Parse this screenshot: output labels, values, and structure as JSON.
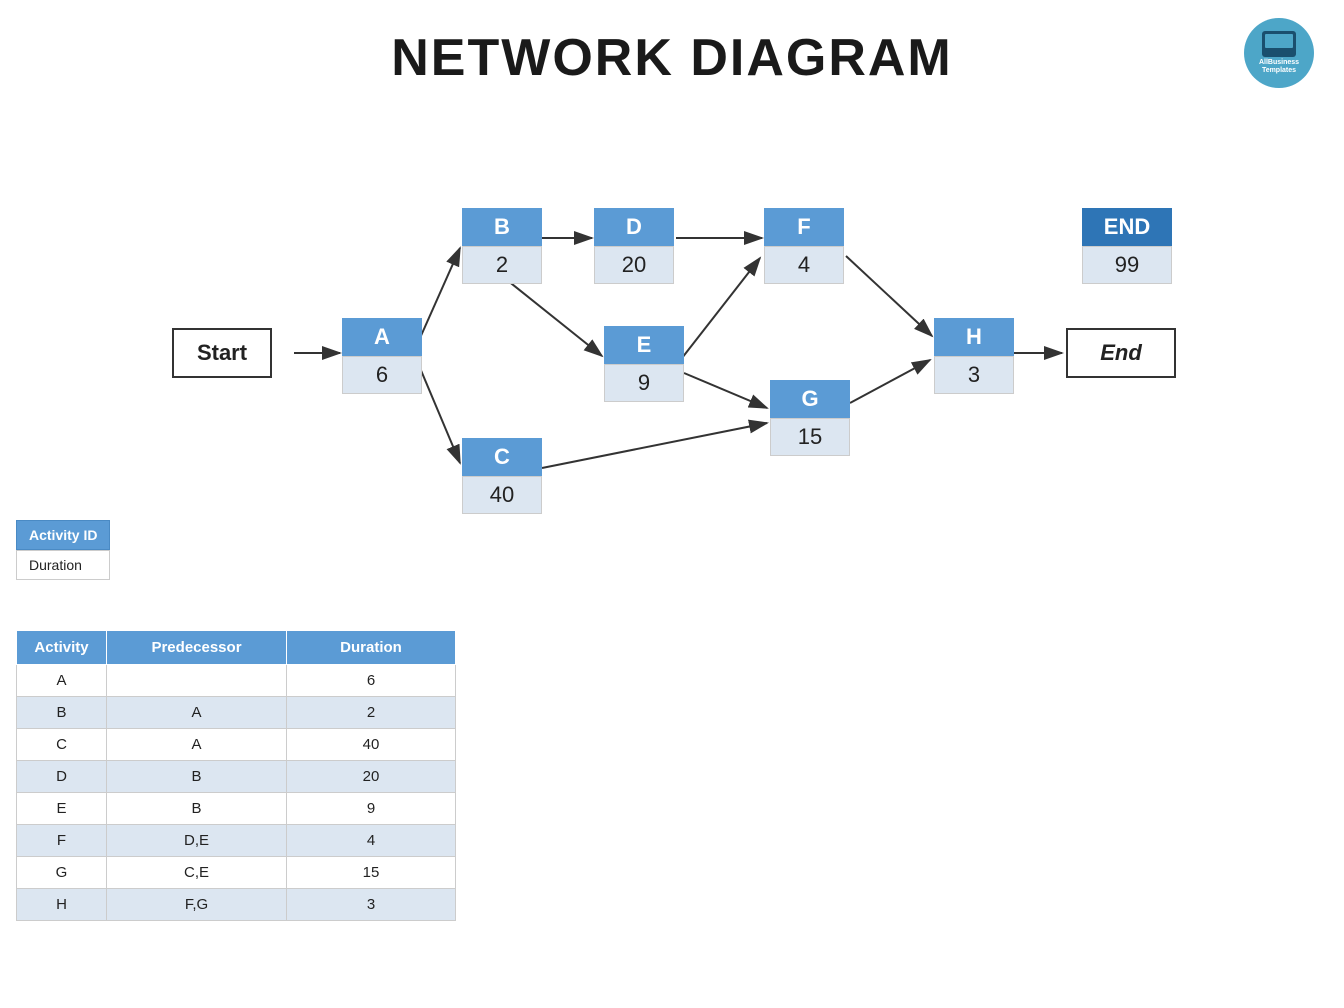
{
  "page": {
    "title": "NETWORK DIAGRAM"
  },
  "logo": {
    "line1": "AllBusiness",
    "line2": "Templates"
  },
  "legend": {
    "activity_label": "Activity ID",
    "duration_label": "Duration"
  },
  "nodes": [
    {
      "id": "start",
      "label": "Start",
      "duration": null,
      "type": "text"
    },
    {
      "id": "A",
      "label": "A",
      "duration": "6",
      "type": "node"
    },
    {
      "id": "B",
      "label": "B",
      "duration": "2",
      "type": "node"
    },
    {
      "id": "C",
      "label": "C",
      "duration": "40",
      "type": "node"
    },
    {
      "id": "D",
      "label": "D",
      "duration": "20",
      "type": "node"
    },
    {
      "id": "E",
      "label": "E",
      "duration": "9",
      "type": "node"
    },
    {
      "id": "F",
      "label": "F",
      "duration": "4",
      "type": "node"
    },
    {
      "id": "G",
      "label": "G",
      "duration": "15",
      "type": "node"
    },
    {
      "id": "H",
      "label": "H",
      "duration": "3",
      "type": "node"
    },
    {
      "id": "END_node",
      "label": "END",
      "duration": "99",
      "type": "end_node"
    },
    {
      "id": "end",
      "label": "End",
      "duration": null,
      "type": "text"
    }
  ],
  "table": {
    "headers": [
      "Activity",
      "Predecessor",
      "Duration"
    ],
    "rows": [
      {
        "activity": "A",
        "predecessor": "",
        "duration": "6"
      },
      {
        "activity": "B",
        "predecessor": "A",
        "duration": "2"
      },
      {
        "activity": "C",
        "predecessor": "A",
        "duration": "40"
      },
      {
        "activity": "D",
        "predecessor": "B",
        "duration": "20"
      },
      {
        "activity": "E",
        "predecessor": "B",
        "duration": "9"
      },
      {
        "activity": "F",
        "predecessor": "D,E",
        "duration": "4"
      },
      {
        "activity": "G",
        "predecessor": "C,E",
        "duration": "15"
      },
      {
        "activity": "H",
        "predecessor": "F,G",
        "duration": "3"
      }
    ]
  }
}
